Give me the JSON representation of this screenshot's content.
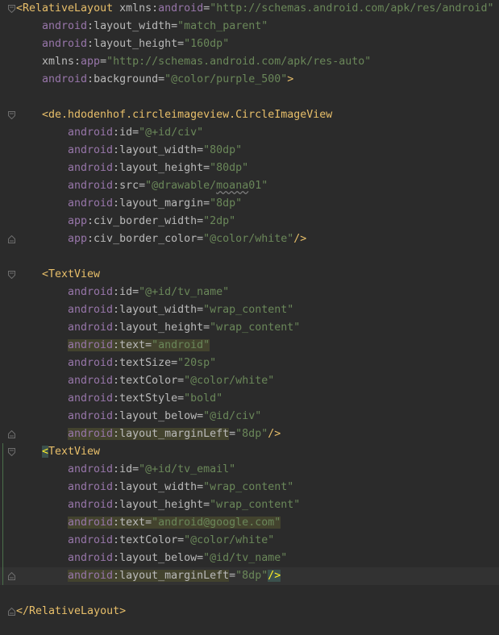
{
  "editor": {
    "lines": [
      {
        "id": "l1",
        "fold": "open",
        "indent": 0,
        "tokens": [
          {
            "t": "tag",
            "v": "<RelativeLayout"
          },
          {
            "t": "punct",
            "v": " "
          },
          {
            "t": "attr",
            "v": "xmlns"
          },
          {
            "t": "punct",
            "v": ":"
          },
          {
            "t": "ns",
            "v": "android"
          },
          {
            "t": "punct",
            "v": "="
          },
          {
            "t": "val",
            "v": "\"http://schemas.android.com/apk/res/android\""
          }
        ]
      },
      {
        "id": "l2",
        "indent": 1,
        "tokens": [
          {
            "t": "ns",
            "v": "android"
          },
          {
            "t": "punct",
            "v": ":"
          },
          {
            "t": "attr",
            "v": "layout_width"
          },
          {
            "t": "punct",
            "v": "="
          },
          {
            "t": "val",
            "v": "\"match_parent\""
          }
        ]
      },
      {
        "id": "l3",
        "indent": 1,
        "tokens": [
          {
            "t": "ns",
            "v": "android"
          },
          {
            "t": "punct",
            "v": ":"
          },
          {
            "t": "attr",
            "v": "layout_height"
          },
          {
            "t": "punct",
            "v": "="
          },
          {
            "t": "val",
            "v": "\"160dp\""
          }
        ]
      },
      {
        "id": "l4",
        "indent": 1,
        "tokens": [
          {
            "t": "attr",
            "v": "xmlns"
          },
          {
            "t": "punct",
            "v": ":"
          },
          {
            "t": "ns",
            "v": "app"
          },
          {
            "t": "punct",
            "v": "="
          },
          {
            "t": "val",
            "v": "\"http://schemas.android.com/apk/res-auto\""
          }
        ]
      },
      {
        "id": "l5",
        "indent": 1,
        "tokens": [
          {
            "t": "ns",
            "v": "android"
          },
          {
            "t": "punct",
            "v": ":"
          },
          {
            "t": "attr",
            "v": "background"
          },
          {
            "t": "punct",
            "v": "="
          },
          {
            "t": "val",
            "v": "\"@color/purple_500\""
          },
          {
            "t": "tag",
            "v": ">"
          }
        ]
      },
      {
        "id": "l6",
        "indent": 0,
        "tokens": []
      },
      {
        "id": "l7",
        "fold": "open",
        "indent": 1,
        "tokens": [
          {
            "t": "tag",
            "v": "<de.hdodenhof.circleimageview.CircleImageView"
          }
        ]
      },
      {
        "id": "l8",
        "indent": 2,
        "tokens": [
          {
            "t": "ns",
            "v": "android"
          },
          {
            "t": "punct",
            "v": ":"
          },
          {
            "t": "attr",
            "v": "id"
          },
          {
            "t": "punct",
            "v": "="
          },
          {
            "t": "val",
            "v": "\"@+id/civ\""
          }
        ]
      },
      {
        "id": "l9",
        "indent": 2,
        "tokens": [
          {
            "t": "ns",
            "v": "android"
          },
          {
            "t": "punct",
            "v": ":"
          },
          {
            "t": "attr",
            "v": "layout_width"
          },
          {
            "t": "punct",
            "v": "="
          },
          {
            "t": "val",
            "v": "\"80dp\""
          }
        ]
      },
      {
        "id": "l10",
        "indent": 2,
        "tokens": [
          {
            "t": "ns",
            "v": "android"
          },
          {
            "t": "punct",
            "v": ":"
          },
          {
            "t": "attr",
            "v": "layout_height"
          },
          {
            "t": "punct",
            "v": "="
          },
          {
            "t": "val",
            "v": "\"80dp\""
          }
        ]
      },
      {
        "id": "l11",
        "indent": 2,
        "tokens": [
          {
            "t": "ns",
            "v": "android"
          },
          {
            "t": "punct",
            "v": ":"
          },
          {
            "t": "attr",
            "v": "src"
          },
          {
            "t": "punct",
            "v": "="
          },
          {
            "t": "val",
            "v": "\"@drawable/"
          },
          {
            "t": "valsquig",
            "v": "moana"
          },
          {
            "t": "val",
            "v": "01\""
          }
        ]
      },
      {
        "id": "l12",
        "indent": 2,
        "tokens": [
          {
            "t": "ns",
            "v": "android"
          },
          {
            "t": "punct",
            "v": ":"
          },
          {
            "t": "attr",
            "v": "layout_margin"
          },
          {
            "t": "punct",
            "v": "="
          },
          {
            "t": "val",
            "v": "\"8dp\""
          }
        ]
      },
      {
        "id": "l13",
        "indent": 2,
        "tokens": [
          {
            "t": "ns",
            "v": "app"
          },
          {
            "t": "punct",
            "v": ":"
          },
          {
            "t": "attr",
            "v": "civ_border_width"
          },
          {
            "t": "punct",
            "v": "="
          },
          {
            "t": "val",
            "v": "\"2dp\""
          }
        ]
      },
      {
        "id": "l14",
        "fold": "close",
        "indent": 2,
        "tokens": [
          {
            "t": "ns",
            "v": "app"
          },
          {
            "t": "punct",
            "v": ":"
          },
          {
            "t": "attr",
            "v": "civ_border_color"
          },
          {
            "t": "punct",
            "v": "="
          },
          {
            "t": "val",
            "v": "\"@color/white\""
          },
          {
            "t": "tag",
            "v": "/>"
          }
        ]
      },
      {
        "id": "l15",
        "indent": 0,
        "tokens": []
      },
      {
        "id": "l16",
        "fold": "open",
        "indent": 1,
        "tokens": [
          {
            "t": "tag",
            "v": "<TextView"
          }
        ]
      },
      {
        "id": "l17",
        "indent": 2,
        "tokens": [
          {
            "t": "ns",
            "v": "android"
          },
          {
            "t": "punct",
            "v": ":"
          },
          {
            "t": "attr",
            "v": "id"
          },
          {
            "t": "punct",
            "v": "="
          },
          {
            "t": "val",
            "v": "\"@+id/tv_name\""
          }
        ]
      },
      {
        "id": "l18",
        "indent": 2,
        "tokens": [
          {
            "t": "ns",
            "v": "android"
          },
          {
            "t": "punct",
            "v": ":"
          },
          {
            "t": "attr",
            "v": "layout_width"
          },
          {
            "t": "punct",
            "v": "="
          },
          {
            "t": "val",
            "v": "\"wrap_content\""
          }
        ]
      },
      {
        "id": "l19",
        "indent": 2,
        "tokens": [
          {
            "t": "ns",
            "v": "android"
          },
          {
            "t": "punct",
            "v": ":"
          },
          {
            "t": "attr",
            "v": "layout_height"
          },
          {
            "t": "punct",
            "v": "="
          },
          {
            "t": "val",
            "v": "\"wrap_content\""
          }
        ]
      },
      {
        "id": "l20",
        "indent": 2,
        "hl": true,
        "tokens": [
          {
            "t": "ns",
            "v": "android"
          },
          {
            "t": "punct",
            "v": ":"
          },
          {
            "t": "attr",
            "v": "text"
          },
          {
            "t": "punct",
            "v": "="
          },
          {
            "t": "val",
            "v": "\"android\""
          }
        ]
      },
      {
        "id": "l21",
        "indent": 2,
        "tokens": [
          {
            "t": "ns",
            "v": "android"
          },
          {
            "t": "punct",
            "v": ":"
          },
          {
            "t": "attr",
            "v": "textSize"
          },
          {
            "t": "punct",
            "v": "="
          },
          {
            "t": "val",
            "v": "\"20sp\""
          }
        ]
      },
      {
        "id": "l22",
        "indent": 2,
        "tokens": [
          {
            "t": "ns",
            "v": "android"
          },
          {
            "t": "punct",
            "v": ":"
          },
          {
            "t": "attr",
            "v": "textColor"
          },
          {
            "t": "punct",
            "v": "="
          },
          {
            "t": "val",
            "v": "\"@color/white\""
          }
        ]
      },
      {
        "id": "l23",
        "indent": 2,
        "tokens": [
          {
            "t": "ns",
            "v": "android"
          },
          {
            "t": "punct",
            "v": ":"
          },
          {
            "t": "attr",
            "v": "textStyle"
          },
          {
            "t": "punct",
            "v": "="
          },
          {
            "t": "val",
            "v": "\"bold\""
          }
        ]
      },
      {
        "id": "l24",
        "indent": 2,
        "tokens": [
          {
            "t": "ns",
            "v": "android"
          },
          {
            "t": "punct",
            "v": ":"
          },
          {
            "t": "attr",
            "v": "layout_below"
          },
          {
            "t": "punct",
            "v": "="
          },
          {
            "t": "val",
            "v": "\"@id/civ\""
          }
        ]
      },
      {
        "id": "l25",
        "fold": "close",
        "indent": 2,
        "hl": true,
        "hlEnd": "attr",
        "tokens": [
          {
            "t": "ns",
            "v": "android"
          },
          {
            "t": "punct",
            "v": ":"
          },
          {
            "t": "attr",
            "v": "layout_marginLeft"
          },
          {
            "t": "punct",
            "v": "="
          },
          {
            "t": "val",
            "v": "\"8dp\""
          },
          {
            "t": "tag",
            "v": "/>"
          }
        ]
      },
      {
        "id": "l26",
        "fold": "open",
        "indent": 1,
        "bracketStart": true,
        "tokens": [
          {
            "t": "tag",
            "v": "<TextView"
          }
        ]
      },
      {
        "id": "l27",
        "indent": 2,
        "tokens": [
          {
            "t": "ns",
            "v": "android"
          },
          {
            "t": "punct",
            "v": ":"
          },
          {
            "t": "attr",
            "v": "id"
          },
          {
            "t": "punct",
            "v": "="
          },
          {
            "t": "val",
            "v": "\"@+id/tv_email\""
          }
        ]
      },
      {
        "id": "l28",
        "indent": 2,
        "tokens": [
          {
            "t": "ns",
            "v": "android"
          },
          {
            "t": "punct",
            "v": ":"
          },
          {
            "t": "attr",
            "v": "layout_width"
          },
          {
            "t": "punct",
            "v": "="
          },
          {
            "t": "val",
            "v": "\"wrap_content\""
          }
        ]
      },
      {
        "id": "l29",
        "indent": 2,
        "tokens": [
          {
            "t": "ns",
            "v": "android"
          },
          {
            "t": "punct",
            "v": ":"
          },
          {
            "t": "attr",
            "v": "layout_height"
          },
          {
            "t": "punct",
            "v": "="
          },
          {
            "t": "val",
            "v": "\"wrap_content\""
          }
        ]
      },
      {
        "id": "l30",
        "indent": 2,
        "hl": true,
        "tokens": [
          {
            "t": "ns",
            "v": "android"
          },
          {
            "t": "punct",
            "v": ":"
          },
          {
            "t": "attr",
            "v": "text"
          },
          {
            "t": "punct",
            "v": "="
          },
          {
            "t": "val",
            "v": "\"android@google.com\""
          }
        ]
      },
      {
        "id": "l31",
        "indent": 2,
        "tokens": [
          {
            "t": "ns",
            "v": "android"
          },
          {
            "t": "punct",
            "v": ":"
          },
          {
            "t": "attr",
            "v": "textColor"
          },
          {
            "t": "punct",
            "v": "="
          },
          {
            "t": "val",
            "v": "\"@color/white\""
          }
        ]
      },
      {
        "id": "l32",
        "indent": 2,
        "tokens": [
          {
            "t": "ns",
            "v": "android"
          },
          {
            "t": "punct",
            "v": ":"
          },
          {
            "t": "attr",
            "v": "layout_below"
          },
          {
            "t": "punct",
            "v": "="
          },
          {
            "t": "val",
            "v": "\"@id/tv_name\""
          }
        ]
      },
      {
        "id": "l33",
        "fold": "close",
        "indent": 2,
        "current": true,
        "hl": true,
        "hlEnd": "attr",
        "bracketEnd": true,
        "tokens": [
          {
            "t": "ns",
            "v": "android"
          },
          {
            "t": "punct",
            "v": ":"
          },
          {
            "t": "attr",
            "v": "layout_marginLeft"
          },
          {
            "t": "punct",
            "v": "="
          },
          {
            "t": "val",
            "v": "\"8dp\""
          },
          {
            "t": "tag",
            "v": "/>"
          }
        ]
      },
      {
        "id": "l34",
        "indent": 0,
        "tokens": []
      },
      {
        "id": "l35",
        "fold": "close",
        "indent": 0,
        "tokens": [
          {
            "t": "tag",
            "v": "</RelativeLayout>"
          }
        ]
      }
    ]
  },
  "colors": {
    "background": "#2b2b2b",
    "tag": "#e8bf6a",
    "namespace": "#9876aa",
    "attribute": "#bababa",
    "value": "#6a8759",
    "highlight": "#3b3a2c",
    "current_line": "#323232"
  },
  "icons": {
    "fold_open": "fold-open-icon",
    "fold_close": "fold-close-icon"
  }
}
